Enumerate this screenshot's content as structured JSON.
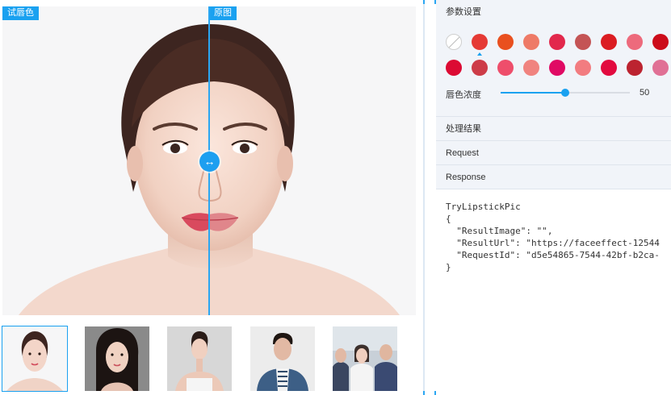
{
  "preview": {
    "label_left": "试唇色",
    "label_right": "原图",
    "handle_icon": "horizontal-arrows-icon"
  },
  "thumbnails": [
    {
      "name": "woman-portrait-1",
      "active": true
    },
    {
      "name": "woman-portrait-2",
      "active": false
    },
    {
      "name": "woman-bare-shoulders",
      "active": false
    },
    {
      "name": "man-denim-jacket",
      "active": false
    },
    {
      "name": "group-photo",
      "active": false
    }
  ],
  "panel": {
    "params_title": "参数设置",
    "swatch_colors": [
      "none",
      "#e53a35",
      "#e9501f",
      "#ee7a67",
      "#e2284c",
      "#c45455",
      "#db1c22",
      "#ed6a7c",
      "#cc0c1a",
      "#dc0a33",
      "#cd3c48",
      "#ee4e6b",
      "#f0837f",
      "#e00a64",
      "#f27c80",
      "#e20a3f",
      "#bc2330",
      "#e07095"
    ],
    "selected_swatch": 1,
    "slider_label": "唇色浓度",
    "slider_value": "50",
    "slider_fraction": 0.5,
    "result_label": "处理结果",
    "request_label": "Request",
    "response_label": "Response",
    "code": "TryLipstickPic\n{\n  \"ResultImage\": \"\",\n  \"ResultUrl\": \"https://faceeffect-12544\n  \"RequestId\": \"d5e54865-7544-42bf-b2ca-\n}"
  },
  "colors": {
    "accent": "#1aa1f0",
    "panel_bg": "#f1f4f9"
  }
}
